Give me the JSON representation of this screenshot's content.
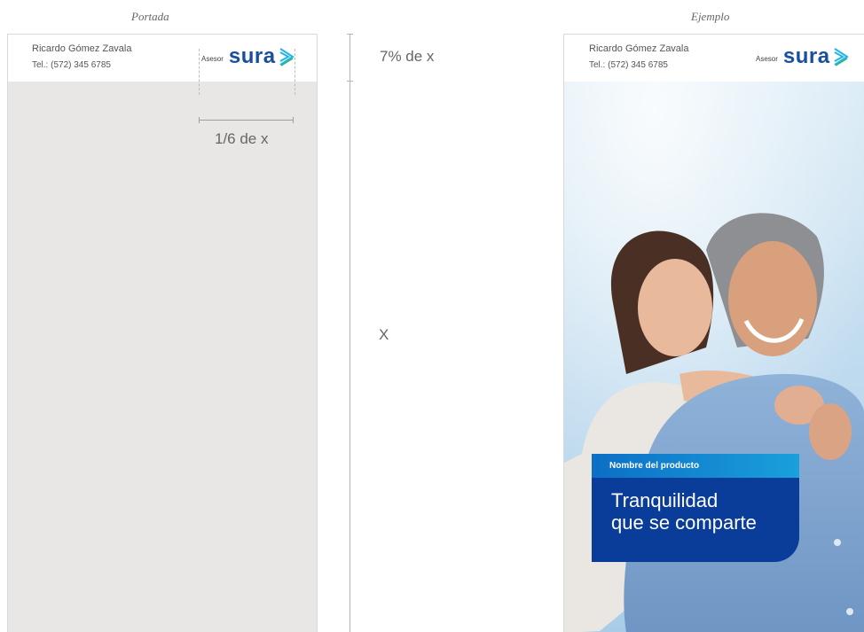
{
  "captions": {
    "left": "Portada",
    "right": "Ejemplo"
  },
  "advisor": {
    "name": "Ricardo Gómez Zavala",
    "phone": "Tel.: (572) 345 6785",
    "role_label": "Asesor"
  },
  "brand": {
    "logo_text": "sura",
    "color": "#1a4fa0",
    "accent": "#22b3e6"
  },
  "measurements": {
    "logo_width": "1/6 de x",
    "header_height": "7% de x",
    "page_height": "X"
  },
  "product": {
    "label": "Nombre del producto",
    "title_line1": "Tranquilidad",
    "title_line2": "que se comparte"
  },
  "colors": {
    "placeholder_bg": "#e8e7e5",
    "product_box": "#0a3d99",
    "product_strip": "#1aa0dc"
  }
}
